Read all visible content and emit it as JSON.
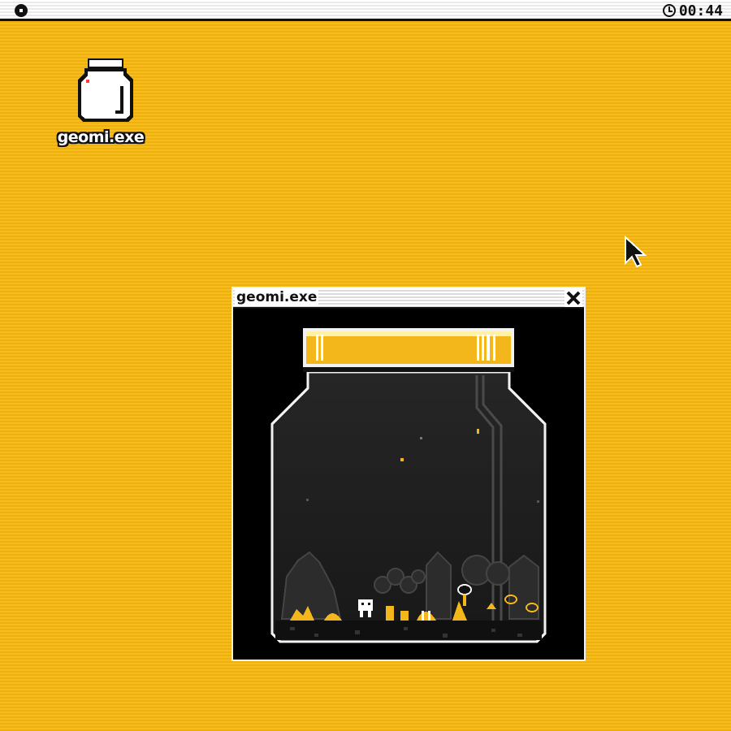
{
  "menubar": {
    "apple_icon": "system-menu-dot",
    "clock": {
      "icon": "clock-icon",
      "time": "00:44"
    }
  },
  "desktop": {
    "icons": [
      {
        "label": "geomi.exe",
        "icon": "jar-icon"
      }
    ]
  },
  "window": {
    "title": "geomi.exe",
    "close_icon": "close-x-icon",
    "content": "terrarium-jar-scene"
  },
  "colors": {
    "desktop": "#f6bd1c",
    "accent": "#f2b81a",
    "window_bg": "#000000",
    "bar_bg": "#ffffff",
    "ink": "#111111"
  }
}
